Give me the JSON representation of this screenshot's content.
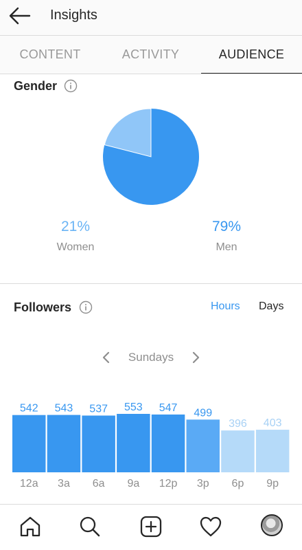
{
  "header": {
    "title": "Insights",
    "back_icon": "arrow-left-icon"
  },
  "tabs": [
    {
      "label": "CONTENT",
      "active": false
    },
    {
      "label": "ACTIVITY",
      "active": false
    },
    {
      "label": "AUDIENCE",
      "active": true
    }
  ],
  "gender": {
    "title": "Gender",
    "women": {
      "pct": "21%",
      "label": "Women",
      "value": 21,
      "color": "#90c6f8"
    },
    "men": {
      "pct": "79%",
      "label": "Men",
      "value": 79,
      "color": "#3897f0"
    }
  },
  "followers": {
    "title": "Followers",
    "toggle_hours": "Hours",
    "toggle_days": "Days",
    "day": "Sundays"
  },
  "chart_data": {
    "type": "bar",
    "categories": [
      "12a",
      "3a",
      "6a",
      "9a",
      "12p",
      "3p",
      "6p",
      "9p"
    ],
    "values": [
      542,
      543,
      537,
      553,
      547,
      499,
      396,
      403
    ],
    "colors": [
      "#3897f0",
      "#3897f0",
      "#3897f0",
      "#3897f0",
      "#3897f0",
      "#5aaaf5",
      "#b5daf9",
      "#b5daf9"
    ],
    "label_colors": [
      "#3897f0",
      "#3897f0",
      "#3897f0",
      "#3897f0",
      "#3897f0",
      "#3897f0",
      "#a8d1f5",
      "#a8d1f5"
    ],
    "ylim": [
      0,
      553
    ]
  },
  "bottom_nav": [
    "home-icon",
    "search-icon",
    "add-post-icon",
    "heart-icon",
    "profile-avatar"
  ]
}
